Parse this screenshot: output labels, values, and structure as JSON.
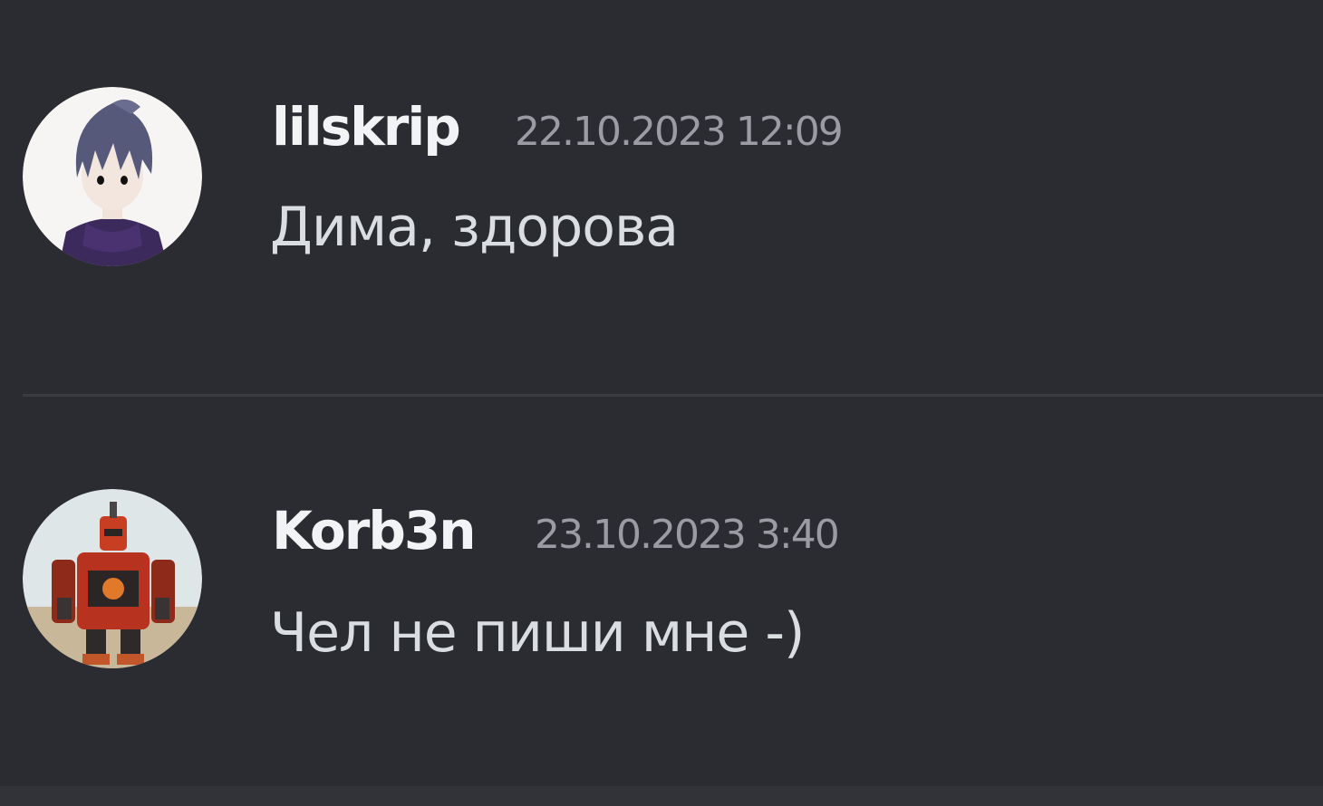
{
  "messages": [
    {
      "username": "lilskrip",
      "timestamp": "22.10.2023 12:09",
      "text": "Дима, здорова",
      "avatar_icon": "anime-character-avatar-icon"
    },
    {
      "username": "Korb3n",
      "timestamp": "23.10.2023 3:40",
      "text": "Чел не пиши мне -)",
      "avatar_icon": "robot-avatar-icon"
    }
  ],
  "colors": {
    "background": "#2b2c31",
    "username": "#f2f3f5",
    "timestamp": "#9a9ba3",
    "message_text": "#dbdee1",
    "divider": "#3b3c42"
  }
}
